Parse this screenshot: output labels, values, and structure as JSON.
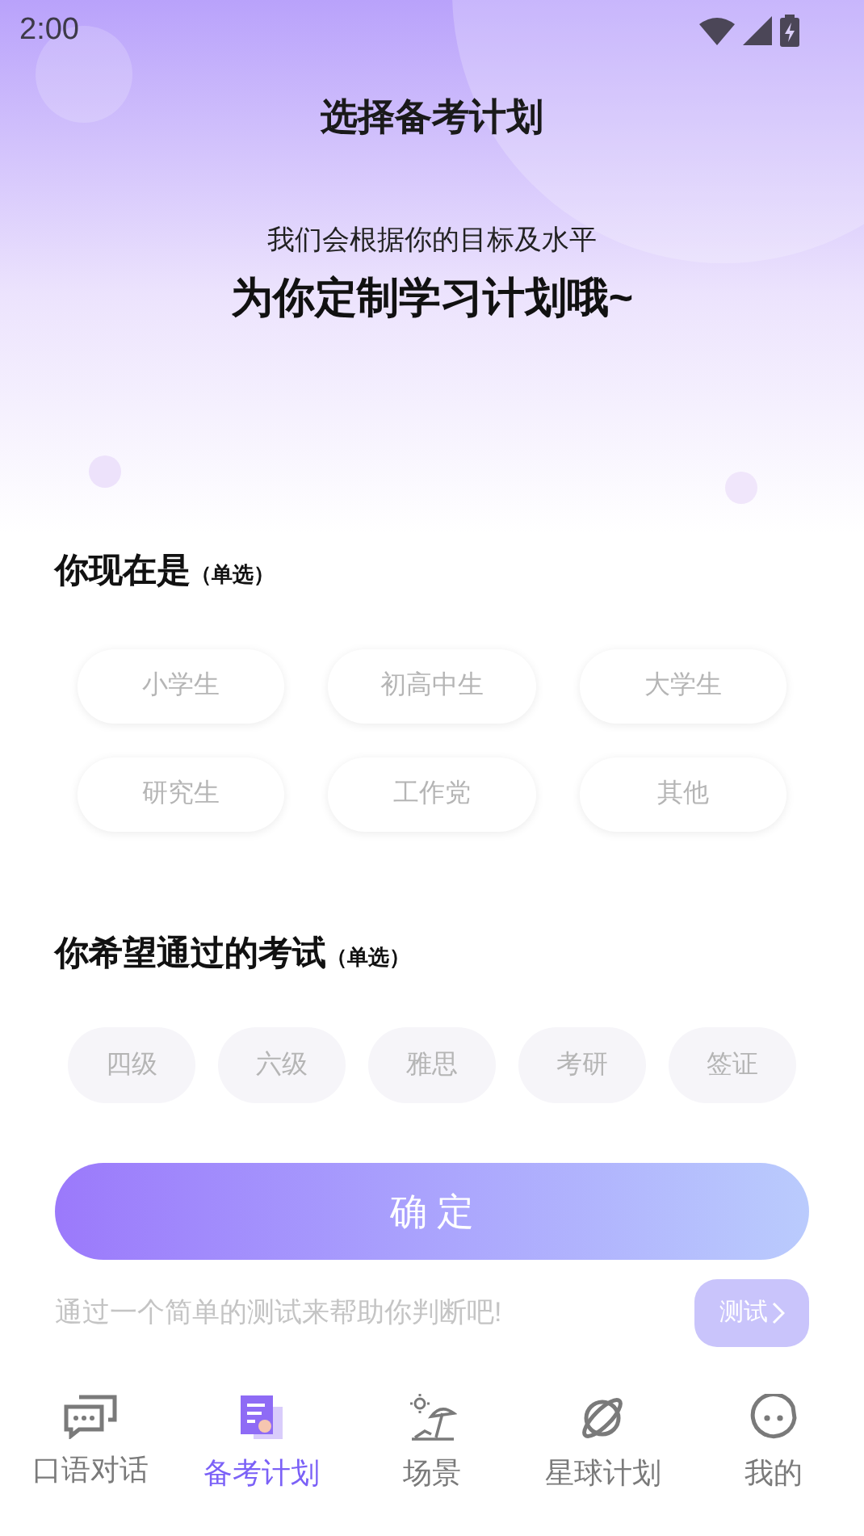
{
  "status_bar": {
    "time": "2:00"
  },
  "header": {
    "title": "选择备考计划",
    "subtitle": "我们会根据你的目标及水平",
    "headline": "为你定制学习计划哦~"
  },
  "identity": {
    "title": "你现在是",
    "note": "（单选）",
    "options": [
      {
        "label": "小学生",
        "selected": false
      },
      {
        "label": "初高中生",
        "selected": false
      },
      {
        "label": "大学生",
        "selected": false
      },
      {
        "label": "研究生",
        "selected": false
      },
      {
        "label": "工作党",
        "selected": false
      },
      {
        "label": "其他",
        "selected": false
      }
    ]
  },
  "exam": {
    "title": "你希望通过的考试",
    "note": "（单选）",
    "options": [
      {
        "label": "四级",
        "selected": false
      },
      {
        "label": "六级",
        "selected": false
      },
      {
        "label": "雅思",
        "selected": false
      },
      {
        "label": "考研",
        "selected": false
      },
      {
        "label": "签证",
        "selected": false
      }
    ]
  },
  "confirm_button": "确 定",
  "test_hint": "通过一个简单的测试来帮助你判断吧!",
  "test_button": "测试",
  "tab_bar": [
    {
      "label": "口语对话",
      "selected": false
    },
    {
      "label": "备考计划",
      "selected": true
    },
    {
      "label": "场景",
      "selected": false
    },
    {
      "label": "星球计划",
      "selected": false
    },
    {
      "label": "我的",
      "selected": false
    }
  ]
}
